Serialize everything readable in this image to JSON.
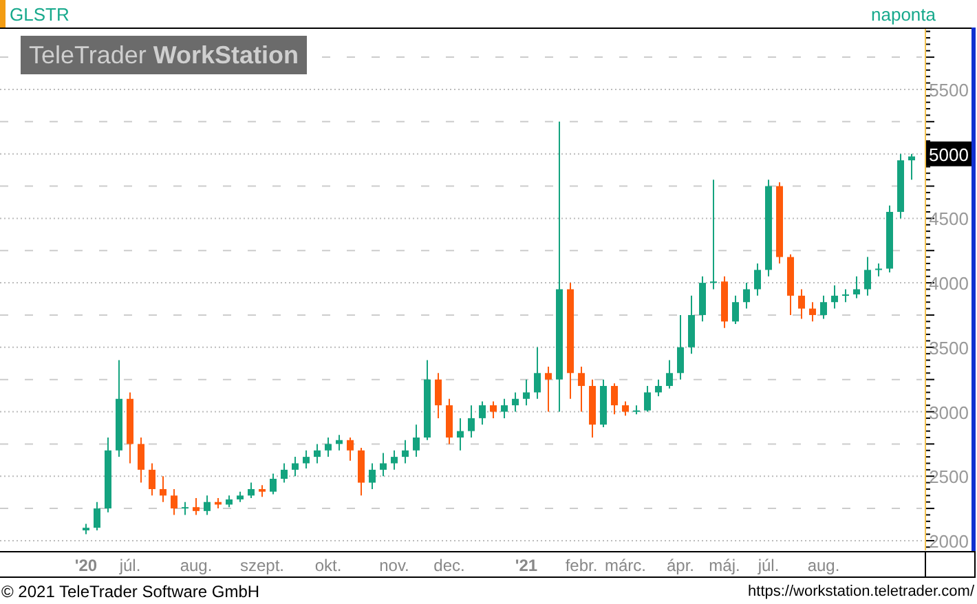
{
  "header": {
    "symbol": "GLSTR",
    "interval": "naponta"
  },
  "logo": "TeleTrader **WorkStation**",
  "chart_data": {
    "type": "candlestick",
    "grid": true,
    "ylim": [
      1925,
      5980
    ],
    "yticks": [
      5500,
      4500,
      4000,
      3500,
      3000,
      2500,
      2000
    ],
    "categories": [
      "'20",
      null,
      null,
      null,
      "júl.",
      null,
      null,
      null,
      null,
      null,
      "aug.",
      null,
      null,
      null,
      null,
      null,
      "szept.",
      null,
      null,
      null,
      null,
      null,
      "okt.",
      null,
      null,
      null,
      null,
      null,
      "nov.",
      null,
      null,
      null,
      null,
      "dec.",
      null,
      null,
      null,
      null,
      null,
      null,
      "'21",
      null,
      null,
      null,
      null,
      "febr.",
      null,
      null,
      null,
      "márc.",
      null,
      null,
      null,
      null,
      "ápr.",
      null,
      null,
      null,
      "máj.",
      null,
      null,
      null,
      "júl.",
      null,
      null,
      null,
      null,
      "aug.",
      null,
      null,
      null,
      null,
      null,
      null,
      null,
      null
    ],
    "ohlc": [
      [
        2080,
        2130,
        2050,
        2100
      ],
      [
        2100,
        2300,
        2080,
        2250
      ],
      [
        2250,
        2800,
        2220,
        2700
      ],
      [
        2700,
        3400,
        2650,
        3100
      ],
      [
        3100,
        3150,
        2600,
        2750
      ],
      [
        2750,
        2800,
        2450,
        2550
      ],
      [
        2550,
        2600,
        2350,
        2400
      ],
      [
        2400,
        2500,
        2300,
        2350
      ],
      [
        2350,
        2400,
        2200,
        2250
      ],
      [
        2250,
        2300,
        2200,
        2260
      ],
      [
        2260,
        2330,
        2200,
        2230
      ],
      [
        2230,
        2350,
        2200,
        2300
      ],
      [
        2300,
        2330,
        2250,
        2280
      ],
      [
        2280,
        2350,
        2260,
        2320
      ],
      [
        2320,
        2380,
        2300,
        2350
      ],
      [
        2350,
        2450,
        2330,
        2400
      ],
      [
        2400,
        2430,
        2340,
        2380
      ],
      [
        2380,
        2520,
        2360,
        2480
      ],
      [
        2480,
        2600,
        2450,
        2550
      ],
      [
        2550,
        2650,
        2500,
        2600
      ],
      [
        2600,
        2700,
        2560,
        2650
      ],
      [
        2650,
        2750,
        2600,
        2700
      ],
      [
        2700,
        2800,
        2650,
        2750
      ],
      [
        2750,
        2820,
        2700,
        2780
      ],
      [
        2780,
        2800,
        2620,
        2700
      ],
      [
        2700,
        2720,
        2350,
        2450
      ],
      [
        2450,
        2600,
        2400,
        2550
      ],
      [
        2550,
        2680,
        2500,
        2600
      ],
      [
        2600,
        2700,
        2550,
        2650
      ],
      [
        2650,
        2780,
        2600,
        2700
      ],
      [
        2700,
        2900,
        2650,
        2800
      ],
      [
        2800,
        3400,
        2780,
        3250
      ],
      [
        3250,
        3300,
        2950,
        3050
      ],
      [
        3050,
        3100,
        2750,
        2800
      ],
      [
        2800,
        2950,
        2700,
        2850
      ],
      [
        2850,
        3050,
        2800,
        2950
      ],
      [
        2950,
        3080,
        2900,
        3050
      ],
      [
        3050,
        3080,
        2950,
        3000
      ],
      [
        3000,
        3100,
        2950,
        3050
      ],
      [
        3050,
        3150,
        3000,
        3100
      ],
      [
        3100,
        3250,
        3050,
        3150
      ],
      [
        3150,
        3500,
        3100,
        3300
      ],
      [
        3300,
        3350,
        3000,
        3250
      ],
      [
        3250,
        5250,
        3000,
        3950
      ],
      [
        3950,
        4000,
        3100,
        3300
      ],
      [
        3300,
        3350,
        3000,
        3200
      ],
      [
        3200,
        3250,
        2800,
        2900
      ],
      [
        2900,
        3250,
        2880,
        3200
      ],
      [
        3200,
        3220,
        2980,
        3050
      ],
      [
        3050,
        3080,
        2970,
        3000
      ],
      [
        3000,
        3050,
        2980,
        3010
      ],
      [
        3010,
        3200,
        3000,
        3150
      ],
      [
        3150,
        3250,
        3120,
        3200
      ],
      [
        3200,
        3400,
        3180,
        3300
      ],
      [
        3300,
        3750,
        3250,
        3500
      ],
      [
        3500,
        3900,
        3450,
        3750
      ],
      [
        3750,
        4050,
        3700,
        4000
      ],
      [
        4000,
        4800,
        3950,
        4010
      ],
      [
        4010,
        4050,
        3650,
        3700
      ],
      [
        3700,
        3900,
        3680,
        3850
      ],
      [
        3850,
        4000,
        3800,
        3950
      ],
      [
        3950,
        4150,
        3900,
        4100
      ],
      [
        4100,
        4800,
        4050,
        4750
      ],
      [
        4750,
        4780,
        4150,
        4200
      ],
      [
        4200,
        4220,
        3750,
        3900
      ],
      [
        3900,
        3950,
        3720,
        3800
      ],
      [
        3800,
        3850,
        3700,
        3750
      ],
      [
        3750,
        3900,
        3720,
        3850
      ],
      [
        3850,
        3980,
        3800,
        3900
      ],
      [
        3900,
        3950,
        3850,
        3910
      ],
      [
        3910,
        4050,
        3880,
        3950
      ],
      [
        3950,
        4200,
        3900,
        4100
      ],
      [
        4100,
        4150,
        4050,
        4110
      ],
      [
        4110,
        4600,
        4080,
        4550
      ],
      [
        4550,
        5000,
        4500,
        4950
      ],
      [
        4950,
        5000,
        4800,
        4980
      ]
    ]
  },
  "price_axis": {
    "last_price": "5000"
  },
  "footer": {
    "copyright": "© 2021 TeleTrader Software GmbH",
    "url": "https://workstation.teletrader.com/"
  }
}
